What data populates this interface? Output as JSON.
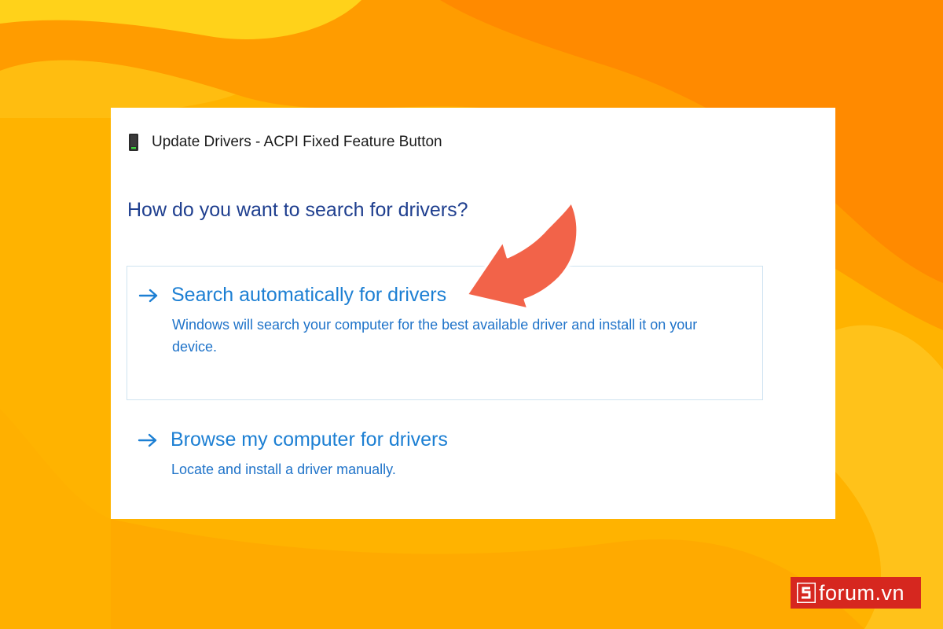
{
  "window": {
    "title": "Update Drivers - ACPI Fixed Feature Button"
  },
  "dialog": {
    "heading": "How do you want to search for drivers?",
    "options": [
      {
        "title": "Search automatically for drivers",
        "description": "Windows will search your computer for the best available driver and install it on your device.",
        "selected": true
      },
      {
        "title": "Browse my computer for drivers",
        "description": "Locate and install a driver manually.",
        "selected": false
      }
    ]
  },
  "watermark": {
    "text": "forum.vn"
  },
  "icons": {
    "title": "device-icon",
    "option": "arrow-right-icon",
    "callout": "red-curved-arrow-icon",
    "watermark_logo": "sforum-s-logo"
  },
  "colors": {
    "background_yellow": "#ffb800",
    "background_orange": "#ff8a00",
    "heading": "#1f3f8f",
    "link": "#1c7fd3",
    "selected_border": "#cfe3f1",
    "callout_arrow": "#f26a4f",
    "watermark_bg": "#d6271f"
  }
}
